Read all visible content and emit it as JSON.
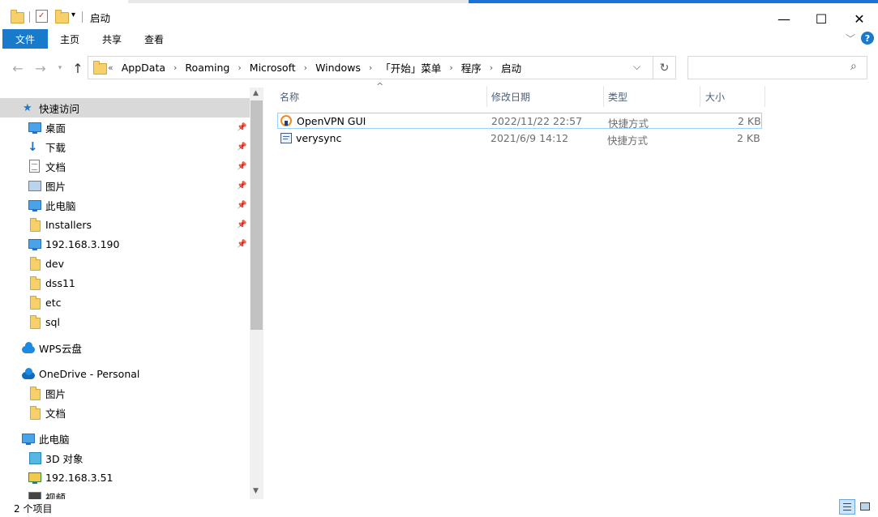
{
  "window": {
    "title": "启动",
    "minimize_glyph": "—",
    "maximize_glyph": "☐",
    "close_glyph": "✕"
  },
  "ribbon": {
    "tabs": [
      {
        "label": "文件",
        "active": true
      },
      {
        "label": "主页"
      },
      {
        "label": "共享"
      },
      {
        "label": "查看"
      }
    ],
    "expand_glyph": "﹀",
    "help_glyph": "?"
  },
  "address": {
    "overflow": "«",
    "crumbs": [
      "AppData",
      "Roaming",
      "Microsoft",
      "Windows",
      "「开始」菜单",
      "程序",
      "启动"
    ],
    "dropdown_glyph": "⌵",
    "refresh_glyph": "↻",
    "search_placeholder": "",
    "search_glyph": "⌕"
  },
  "nav": {
    "items": [
      {
        "label": "快速访问",
        "icon": "star-icon"
      },
      {
        "label": "桌面",
        "icon": "desktop-icon",
        "pinned": true
      },
      {
        "label": "下载",
        "icon": "download-icon",
        "pinned": true
      },
      {
        "label": "文档",
        "icon": "document-icon",
        "pinned": true
      },
      {
        "label": "图片",
        "icon": "picture-icon",
        "pinned": true
      },
      {
        "label": "此电脑",
        "icon": "computer-icon",
        "pinned": true
      },
      {
        "label": "Installers",
        "icon": "folder-icon",
        "pinned": true
      },
      {
        "label": "192.168.3.190",
        "icon": "network-drive-icon",
        "pinned": true
      },
      {
        "label": "dev",
        "icon": "folder-icon"
      },
      {
        "label": "dss11",
        "icon": "folder-icon"
      },
      {
        "label": "etc",
        "icon": "folder-icon"
      },
      {
        "label": "sql",
        "icon": "folder-icon"
      },
      {
        "label": "WPS云盘",
        "icon": "wps-cloud-icon"
      },
      {
        "label": "OneDrive - Personal",
        "icon": "onedrive-icon"
      },
      {
        "label": "图片",
        "icon": "folder-icon"
      },
      {
        "label": "文档",
        "icon": "folder-icon"
      },
      {
        "label": "此电脑",
        "icon": "computer-icon"
      },
      {
        "label": "3D 对象",
        "icon": "3d-objects-icon"
      },
      {
        "label": "192.168.3.51",
        "icon": "network-location-icon"
      },
      {
        "label": "视频",
        "icon": "video-icon"
      }
    ],
    "pin_glyph": "📌"
  },
  "content": {
    "sort_glyph": "^",
    "columns": [
      "名称",
      "修改日期",
      "类型",
      "大小"
    ],
    "files": [
      {
        "name": "OpenVPN GUI",
        "date": "2022/11/22 22:57",
        "type": "快捷方式",
        "size": "2 KB",
        "icon": "openvpn-icon"
      },
      {
        "name": "verysync",
        "date": "2021/6/9 14:12",
        "type": "快捷方式",
        "size": "2 KB",
        "icon": "shortcut-icon"
      }
    ]
  },
  "status": {
    "count": "2 个项目"
  },
  "colors": {
    "accent": "#1979ca",
    "selected_nav": "#d9d9d9",
    "header_text": "#4c607a",
    "row_border": "#99d1ff"
  }
}
